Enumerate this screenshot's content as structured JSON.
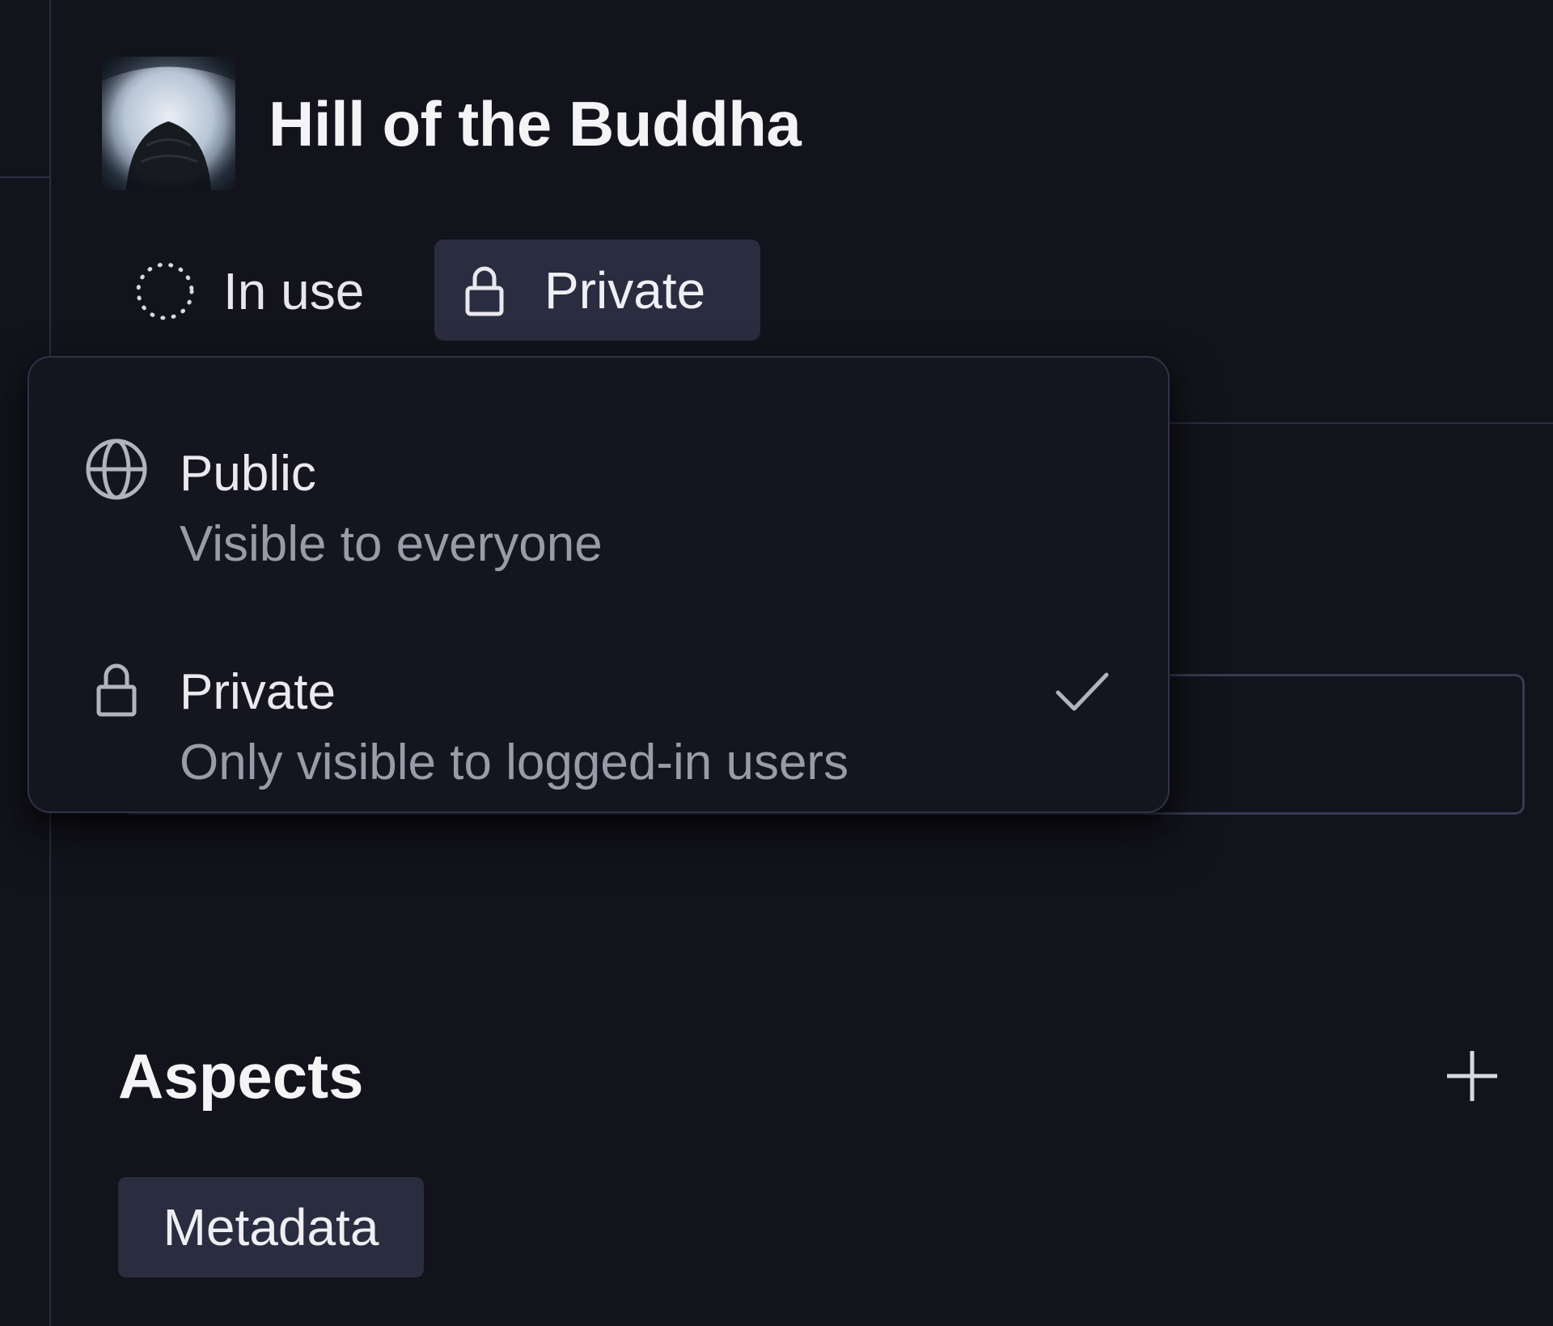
{
  "header": {
    "title": "Hill of the Buddha",
    "thumbnail_icon": "image-thumbnail"
  },
  "status": {
    "label": "In use",
    "icon": "dashed-circle-icon"
  },
  "visibility_button": {
    "label": "Private",
    "icon": "lock-icon"
  },
  "visibility_menu": {
    "options": [
      {
        "title": "Public",
        "description": "Visible to everyone",
        "icon": "globe-icon",
        "selected": false
      },
      {
        "title": "Private",
        "description": "Only visible to logged-in users",
        "icon": "lock-icon",
        "selected": true
      }
    ]
  },
  "aspects": {
    "title": "Aspects",
    "add_icon": "plus-icon",
    "chips": [
      "Metadata"
    ]
  },
  "colors": {
    "background": "#13131c",
    "chip_background": "#2a2d40",
    "menu_background": "#151520",
    "border": "#2f3346",
    "muted_text": "#9a9aa8"
  }
}
